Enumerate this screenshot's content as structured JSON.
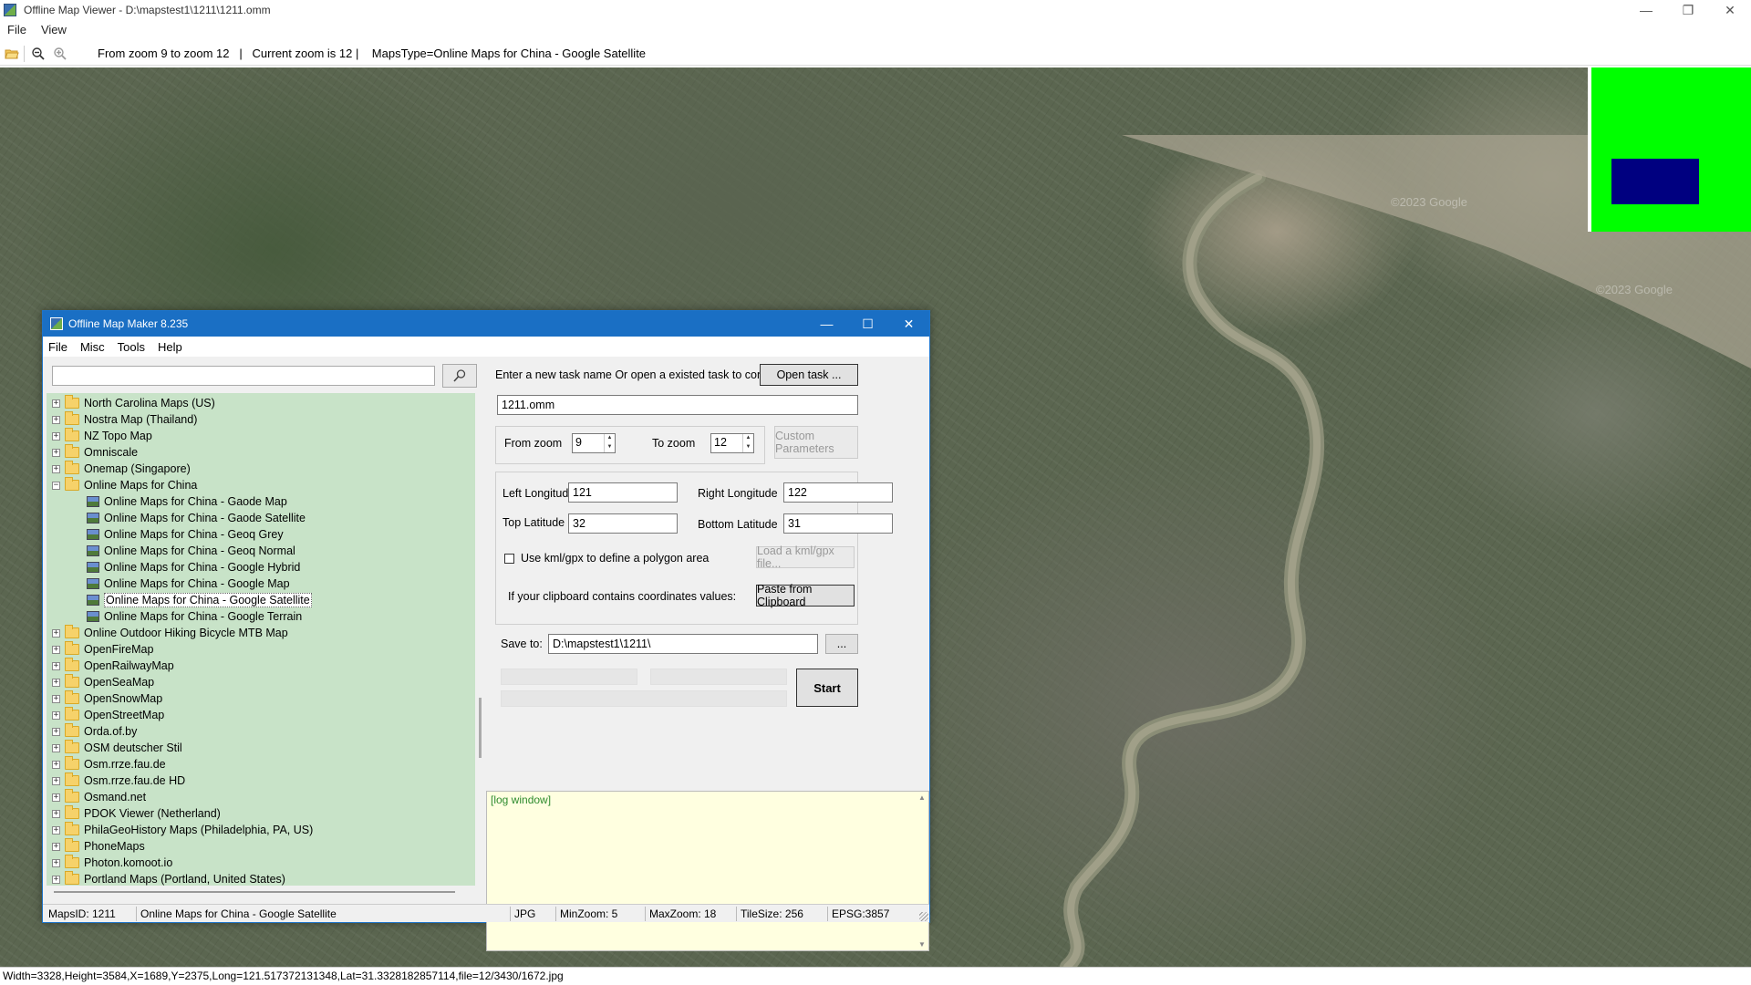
{
  "viewer": {
    "title": "Offline Map Viewer - D:\\mapstest1\\1211\\1211.omm",
    "menu": [
      "File",
      "View"
    ],
    "toolbar_status": "From zoom 9 to zoom 12   |   Current zoom is 12 |    MapsType=Online Maps for China - Google Satellite",
    "watermarks": [
      "©2023 Google",
      "©2023 Google"
    ],
    "bottom_status": "Width=3328,Height=3584,X=1689,Y=2375,Long=121.517372131348,Lat=31.3328182857114,file=12/3430/1672.jpg"
  },
  "dialog": {
    "title": "Offline Map Maker 8.235",
    "menu": [
      "File",
      "Misc",
      "Tools",
      "Help"
    ],
    "search_value": "",
    "tree": [
      {
        "label": "North Carolina Maps (US)",
        "type": "folder",
        "expander": "+"
      },
      {
        "label": "Nostra Map (Thailand)",
        "type": "folder",
        "expander": "+"
      },
      {
        "label": "NZ Topo Map",
        "type": "folder",
        "expander": "+"
      },
      {
        "label": "Omniscale",
        "type": "folder",
        "expander": "+"
      },
      {
        "label": "Onemap (Singapore)",
        "type": "folder",
        "expander": "+"
      },
      {
        "label": "Online Maps for China",
        "type": "folder-open",
        "expander": "−"
      },
      {
        "label": "Online Maps for China - Gaode Map",
        "type": "map"
      },
      {
        "label": "Online Maps for China - Gaode Satellite",
        "type": "map"
      },
      {
        "label": "Online Maps for China - Geoq Grey",
        "type": "map"
      },
      {
        "label": "Online Maps for China - Geoq Normal",
        "type": "map"
      },
      {
        "label": "Online Maps for China - Google Hybrid",
        "type": "map"
      },
      {
        "label": "Online Maps for China - Google Map",
        "type": "map"
      },
      {
        "label": "Online Maps for China - Google Satellite",
        "type": "map",
        "selected": true
      },
      {
        "label": "Online Maps for China - Google Terrain",
        "type": "map"
      },
      {
        "label": "Online Outdoor Hiking Bicycle MTB Map",
        "type": "folder",
        "expander": "+"
      },
      {
        "label": "OpenFireMap",
        "type": "folder",
        "expander": "+"
      },
      {
        "label": "OpenRailwayMap",
        "type": "folder",
        "expander": "+"
      },
      {
        "label": "OpenSeaMap",
        "type": "folder",
        "expander": "+"
      },
      {
        "label": "OpenSnowMap",
        "type": "folder",
        "expander": "+"
      },
      {
        "label": "OpenStreetMap",
        "type": "folder",
        "expander": "+"
      },
      {
        "label": "Orda.of.by",
        "type": "folder",
        "expander": "+"
      },
      {
        "label": "OSM deutscher Stil",
        "type": "folder",
        "expander": "+"
      },
      {
        "label": "Osm.rrze.fau.de",
        "type": "folder",
        "expander": "+"
      },
      {
        "label": "Osm.rrze.fau.de HD",
        "type": "folder",
        "expander": "+"
      },
      {
        "label": "Osmand.net",
        "type": "folder",
        "expander": "+"
      },
      {
        "label": "PDOK Viewer (Netherland)",
        "type": "folder",
        "expander": "+"
      },
      {
        "label": "PhilaGeoHistory Maps (Philadelphia, PA, US)",
        "type": "folder",
        "expander": "+"
      },
      {
        "label": "PhoneMaps",
        "type": "folder",
        "expander": "+"
      },
      {
        "label": "Photon.komoot.io",
        "type": "folder",
        "expander": "+"
      },
      {
        "label": "Portland Maps (Portland, United States)",
        "type": "folder",
        "expander": "+"
      }
    ],
    "task_prompt": "Enter a new task name Or open a existed task to continue:",
    "open_task_label": "Open task ...",
    "task_name": "1211.omm",
    "from_zoom_label": "From zoom",
    "from_zoom": "9",
    "to_zoom_label": "To zoom",
    "to_zoom": "12",
    "custom_params_label": "Custom Parameters",
    "left_lon_label": "Left Longitude",
    "left_lon": "121",
    "right_lon_label": "Right Longitude",
    "right_lon": "122",
    "top_lat_label": "Top Latitude",
    "top_lat": "32",
    "bottom_lat_label": "Bottom Latitude",
    "bottom_lat": "31",
    "kml_label": "Use kml/gpx to define a polygon area",
    "load_kml_label": "Load a kml/gpx file...",
    "clipboard_label": "If your clipboard contains coordinates values:",
    "paste_label": "Paste from Clipboard",
    "save_to_label": "Save to:",
    "save_to": "D:\\mapstest1\\1211\\",
    "browse_label": "...",
    "start_label": "Start",
    "log_text": "[log window]",
    "status": {
      "maps_id": "MapsID: 1211",
      "map_name": "Online Maps for China - Google Satellite",
      "format": "JPG",
      "min_zoom": "MinZoom: 5",
      "max_zoom": "MaxZoom: 18",
      "tile_size": "TileSize: 256",
      "epsg": "EPSG:3857"
    }
  },
  "colors": {
    "dialog_title_bg": "#1a6fc4",
    "tree_bg": "#c8e3c8",
    "log_bg": "#ffffe0",
    "log_text": "#2e8b2e",
    "overview_bg": "#00ff00",
    "overview_box": "#000080"
  }
}
